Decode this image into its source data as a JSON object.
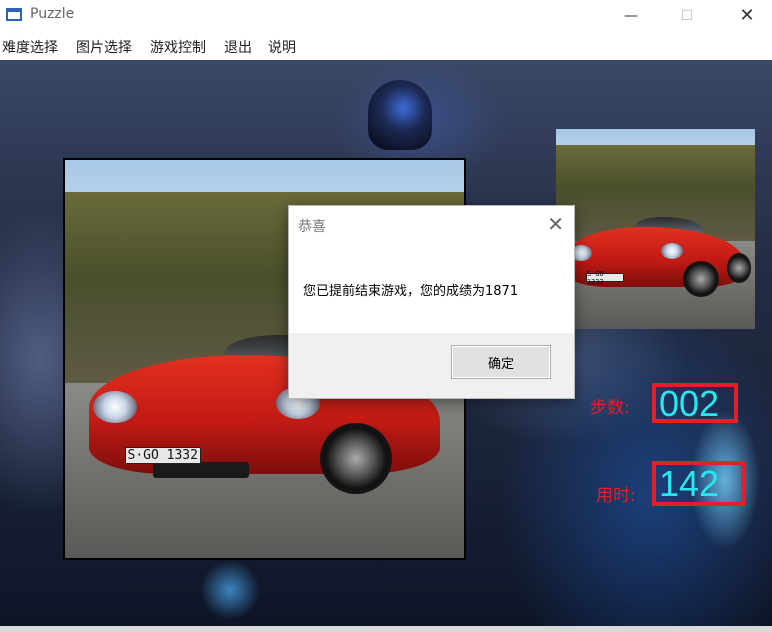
{
  "window": {
    "title": "Puzzle",
    "minimize": "—",
    "maximize": "☐",
    "close": "✕"
  },
  "menu": [
    "难度选择",
    "图片选择",
    "游戏控制",
    "退出",
    "说明"
  ],
  "photo": {
    "plate": "S·GO 1332"
  },
  "stats": {
    "steps_label": "步数:",
    "steps_value": "002",
    "time_label": "用时:",
    "time_value": "142"
  },
  "dialog": {
    "title": "恭喜",
    "close": "✕",
    "message": "您已提前结束游戏，您的成绩为1871",
    "ok": "确定"
  },
  "colors": {
    "stat_label": "#e0202a",
    "stat_value": "#26e8f0",
    "stat_border": "#e3202a"
  },
  "icons": {
    "app": "window-app-icon"
  }
}
